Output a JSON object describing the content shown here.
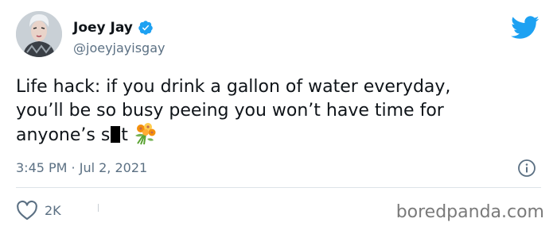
{
  "author": {
    "name": "Joey Jay",
    "handle": "@joeyjayisgay",
    "verified": true
  },
  "tweet": {
    "line1": "Life hack: if you drink a gallon of water everyday,",
    "line2": "you’ll be so busy peeing you won’t have time for",
    "line3_before": "anyone’s s",
    "line3_after": "t",
    "emoji": "bouquet-icon"
  },
  "meta": {
    "timestamp": "3:45 PM · Jul 2, 2021"
  },
  "actions": {
    "like_count": "2K"
  },
  "watermark": "boredpanda.com",
  "colors": {
    "twitter_blue": "#1da1f2",
    "secondary_text": "#5b7083",
    "divider": "#dde3e8"
  }
}
